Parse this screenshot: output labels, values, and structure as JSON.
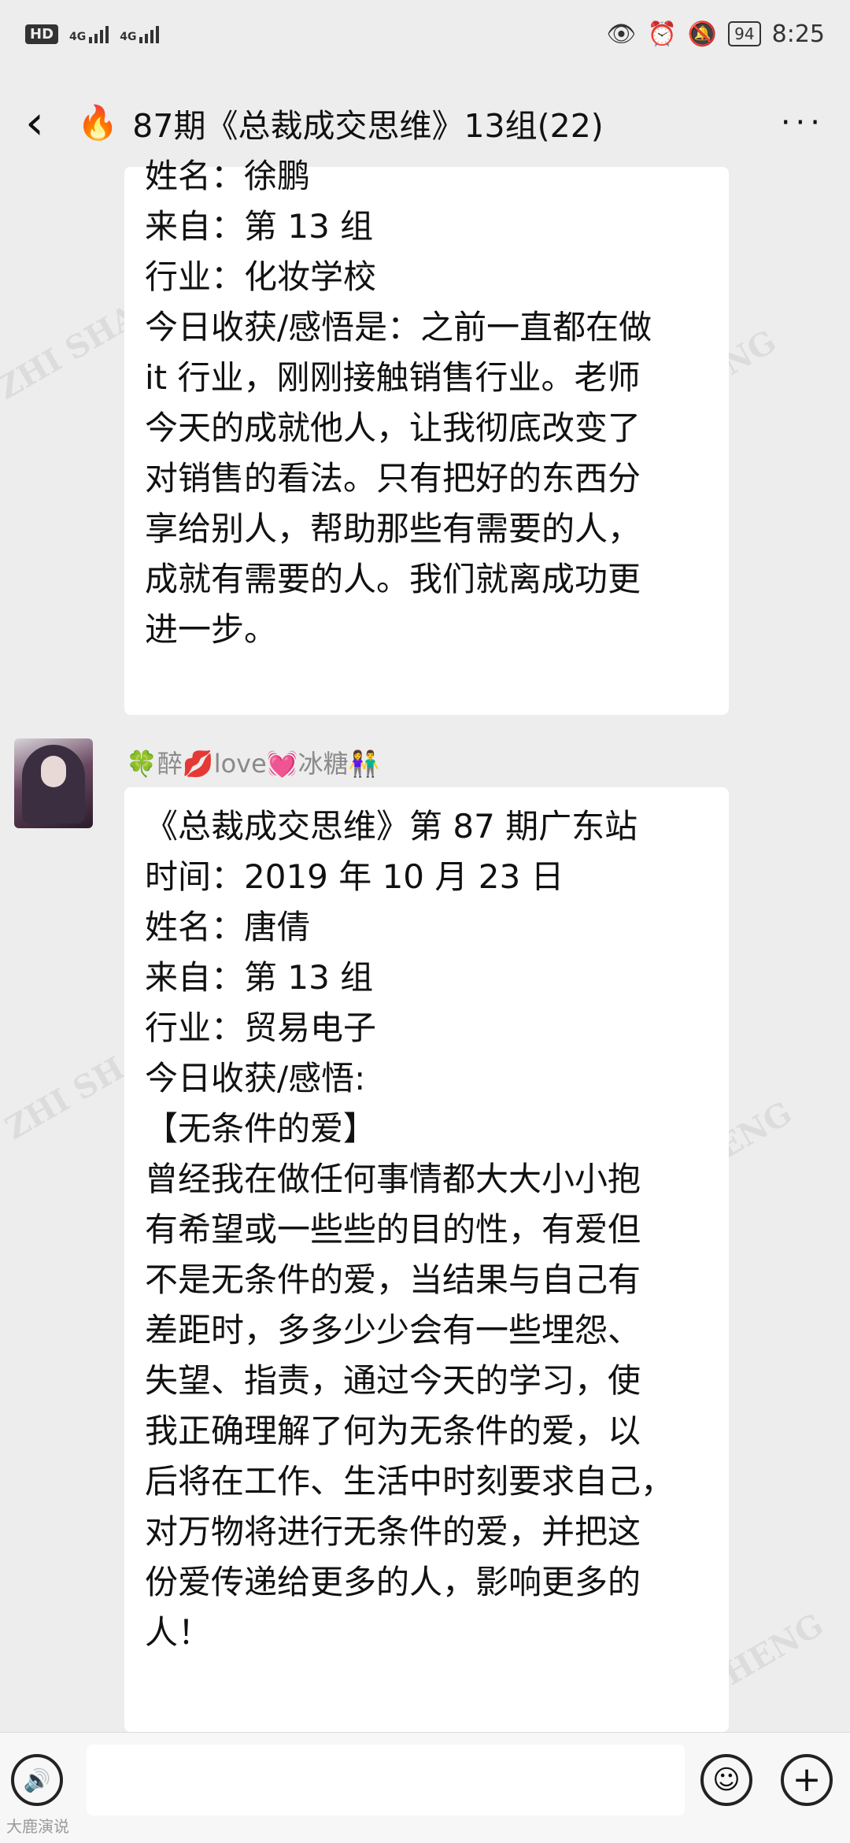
{
  "status": {
    "hd": "HD",
    "net1": "4G",
    "net2": "4G",
    "battery": "94",
    "time": "8:25"
  },
  "header": {
    "title": "87期《总裁成交思维》13组(22)",
    "back": "‹",
    "fire": "🔥",
    "more": "···"
  },
  "messages": [
    {
      "lines": [
        "姓名：徐鹏",
        "来自：第 13 组",
        "行业：化妆学校",
        "今日收获/感悟是：之前一直都在做",
        "it 行业，刚刚接触销售行业。老师",
        "今天的成就他人，让我彻底改变了",
        "对销售的看法。只有把好的东西分",
        "享给别人，帮助那些有需要的人，",
        "成就有需要的人。我们就离成功更",
        "进一步。"
      ]
    },
    {
      "sender": "🍀醉💋love💓冰糖👫",
      "lines": [
        "《总裁成交思维》第 87 期广东站",
        "时间：2019 年 10 月 23 日",
        "姓名：唐倩",
        "来自：第 13 组",
        "行业：贸易电子",
        "今日收获/感悟:",
        "【无条件的爱】",
        "曾经我在做任何事情都大大小小抱",
        "有希望或一些些的目的性，有爱但",
        "不是无条件的爱，当结果与自己有",
        "差距时，多多少少会有一些埋怨、",
        "失望、指责，通过今天的学习，使",
        "我正确理解了何为无条件的爱，以",
        "后将在工作、生活中时刻要求自己，",
        "对万物将进行无条件的爱，并把这",
        "份爱传递给更多的人，影响更多的",
        "人！"
      ]
    }
  ],
  "watermark": {
    "text": "ZHI SHANG CHENG",
    "bottom": "大鹿演说"
  }
}
